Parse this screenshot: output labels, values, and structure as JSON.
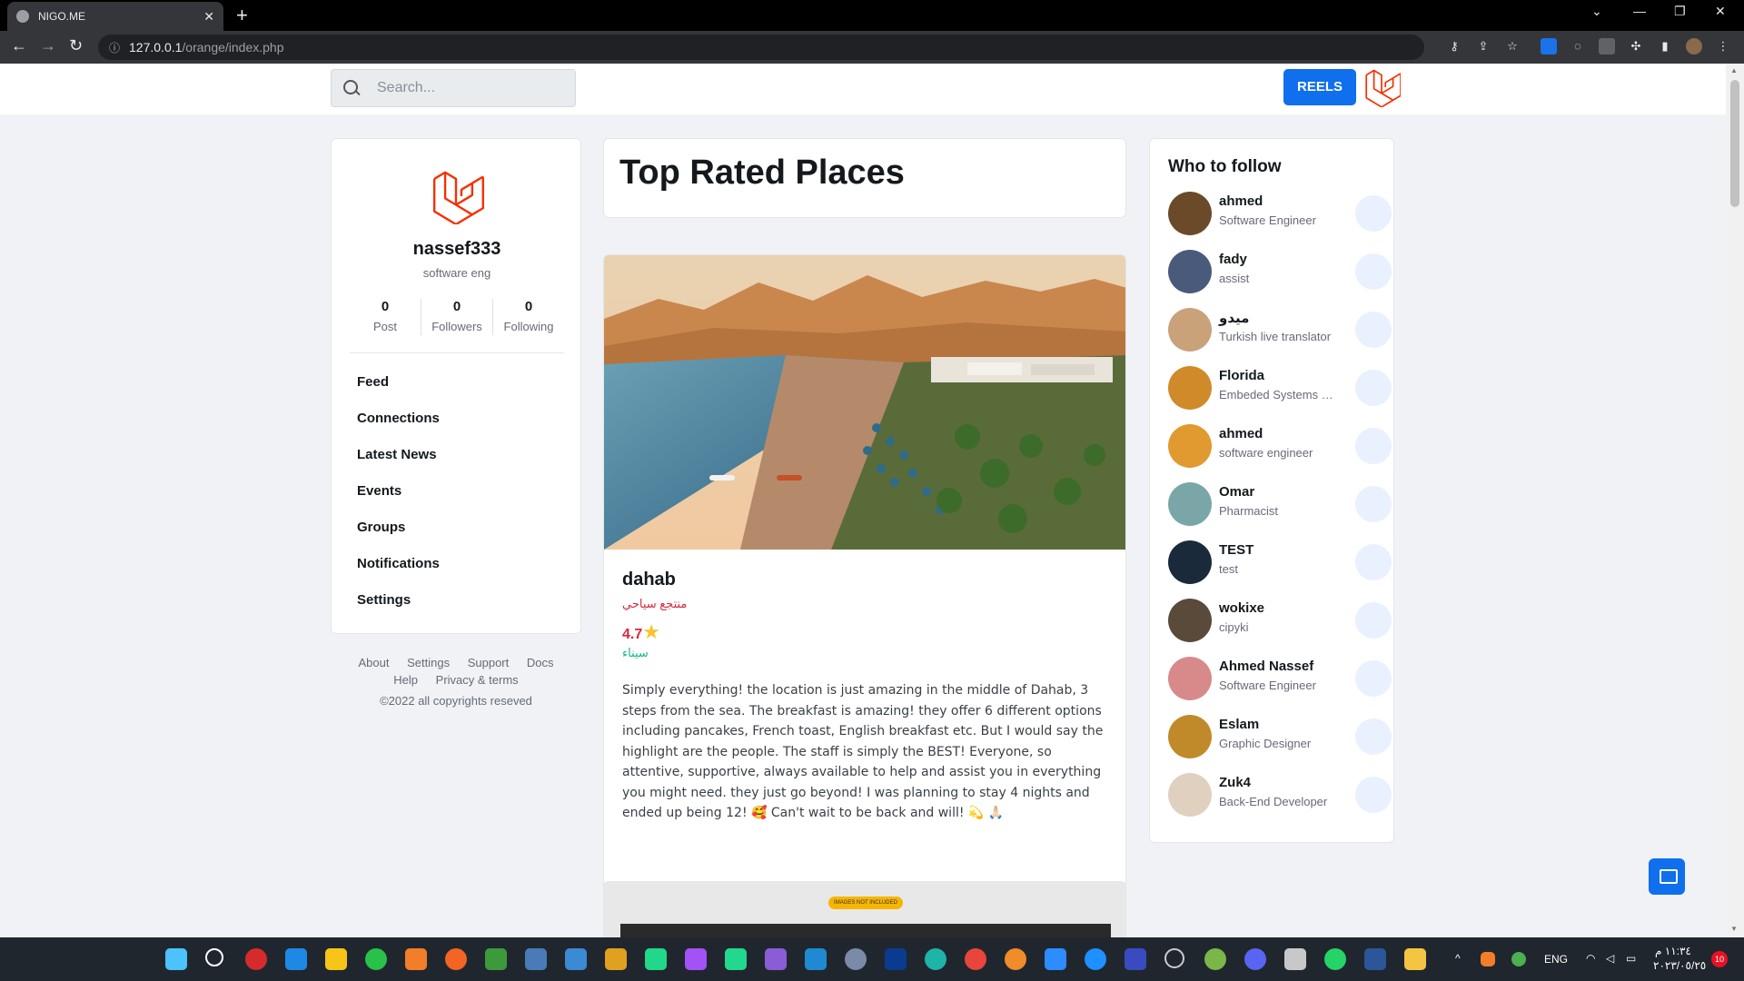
{
  "browser": {
    "tab_title": "NIGO.ME",
    "tab_close": "✕",
    "new_tab": "+",
    "url_host": "127.0.0.1",
    "url_path": "/orange/index.php"
  },
  "header": {
    "search_placeholder": "Search...",
    "reels_label": "REELS"
  },
  "profile": {
    "name": "nassef333",
    "role": "software eng",
    "stats": [
      {
        "value": "0",
        "label": "Post"
      },
      {
        "value": "0",
        "label": "Followers"
      },
      {
        "value": "0",
        "label": "Following"
      }
    ],
    "menu": [
      "Feed",
      "Connections",
      "Latest News",
      "Events",
      "Groups",
      "Notifications",
      "Settings"
    ]
  },
  "footer": {
    "row1": [
      "About",
      "Settings",
      "Support",
      "Docs"
    ],
    "row2": [
      "Help",
      "Privacy & terms"
    ],
    "copyright": "©2022 all copyrights reseved"
  },
  "main": {
    "title": "Top Rated Places",
    "place": {
      "name": "dahab",
      "type": "منتجع سياحي",
      "rating": "4.7",
      "location": "سيناء",
      "description": "Simply everything! the location is just amazing in the middle of Dahab, 3 steps from the sea. The breakfast is amazing! they offer 6 different options including pancakes, French toast, English breakfast etc. But I would say the highlight are the people. The staff is simply the BEST! Everyone, so attentive, supportive, always available to help and assist you in everything you might need. they just go beyond! I was planning to stay 4 nights and ended up being 12! 🥰 Can't wait to be back and will! 💫 🙏🏻"
    },
    "next_badge": "IMAGES NOT INCLUDED"
  },
  "who_to_follow": {
    "title": "Who to follow",
    "people": [
      {
        "name": "ahmed",
        "subtitle": "Software Engineer",
        "color": "#6b4a2a"
      },
      {
        "name": "fady",
        "subtitle": "assist",
        "color": "#4a5a7a"
      },
      {
        "name": "ميدو",
        "subtitle": "Turkish live translator",
        "color": "#c9a27a"
      },
      {
        "name": "Florida",
        "subtitle": "Embeded Systems Engineer",
        "color": "#d08a2a"
      },
      {
        "name": "ahmed",
        "subtitle": "software engineer",
        "color": "#e09a30"
      },
      {
        "name": "Omar",
        "subtitle": "Pharmacist",
        "color": "#7aa6a8"
      },
      {
        "name": "TEST",
        "subtitle": "test",
        "color": "#1b2a3a"
      },
      {
        "name": "wokixe",
        "subtitle": "cipyki",
        "color": "#5a4a3a"
      },
      {
        "name": "Ahmed Nassef",
        "subtitle": "Software Engineer",
        "color": "#d88a8a"
      },
      {
        "name": "Eslam",
        "subtitle": "Graphic Designer",
        "color": "#c08a2a"
      },
      {
        "name": "Zuk4",
        "subtitle": "Back-End Developer",
        "color": "#e0d0c0"
      }
    ]
  },
  "taskbar": {
    "lang": "ENG",
    "time": "١١:٣٤ م",
    "date": "٢٠٢٣/٠٥/٢٥",
    "notif_count": "10"
  }
}
